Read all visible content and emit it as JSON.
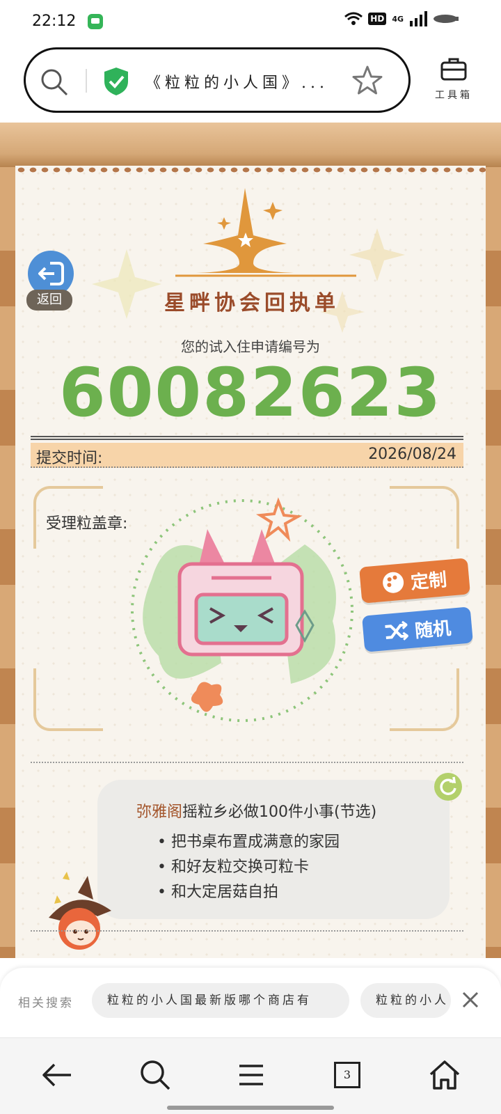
{
  "status_bar": {
    "time": "22:12",
    "hd_badge": "HD",
    "network": "4G",
    "icons": [
      "message-app-icon",
      "wifi-icon",
      "signal-icon",
      "battery-icon"
    ]
  },
  "address_bar": {
    "title": "《粒粒的小人国》...",
    "icons": [
      "search-icon",
      "shield-check-icon",
      "star-icon"
    ],
    "shield_color": "#2fb25a"
  },
  "toolbox": {
    "label": "工具箱",
    "icon": "toolbox-icon"
  },
  "page": {
    "back_label": "返回",
    "logo_title": "星畔协会回执单",
    "subtitle": "您的试入住申请编号为",
    "application_number": "60082623",
    "number_color": "#6cb04e",
    "submit_label": "提交时间:",
    "submit_date": "2026/08/24",
    "stamp_label": "受理粒盖章:",
    "buttons": {
      "custom": "定制",
      "random": "随机"
    },
    "tip": {
      "author": "弥雅阁",
      "title_rest": "摇粒乡必做100件小事(节选)",
      "items": [
        "把书桌布置成满意的家园",
        "和好友粒交换可粒卡",
        "和大定居菇自拍"
      ]
    }
  },
  "related_search": {
    "label": "相关搜索",
    "chips": [
      "粒粒的小人国最新版哪个商店有",
      "粒粒的小人"
    ]
  },
  "bottom_nav": {
    "tab_count": "3",
    "icons": [
      "back-arrow-icon",
      "search-icon",
      "menu-icon",
      "tabs-icon",
      "home-icon"
    ]
  }
}
